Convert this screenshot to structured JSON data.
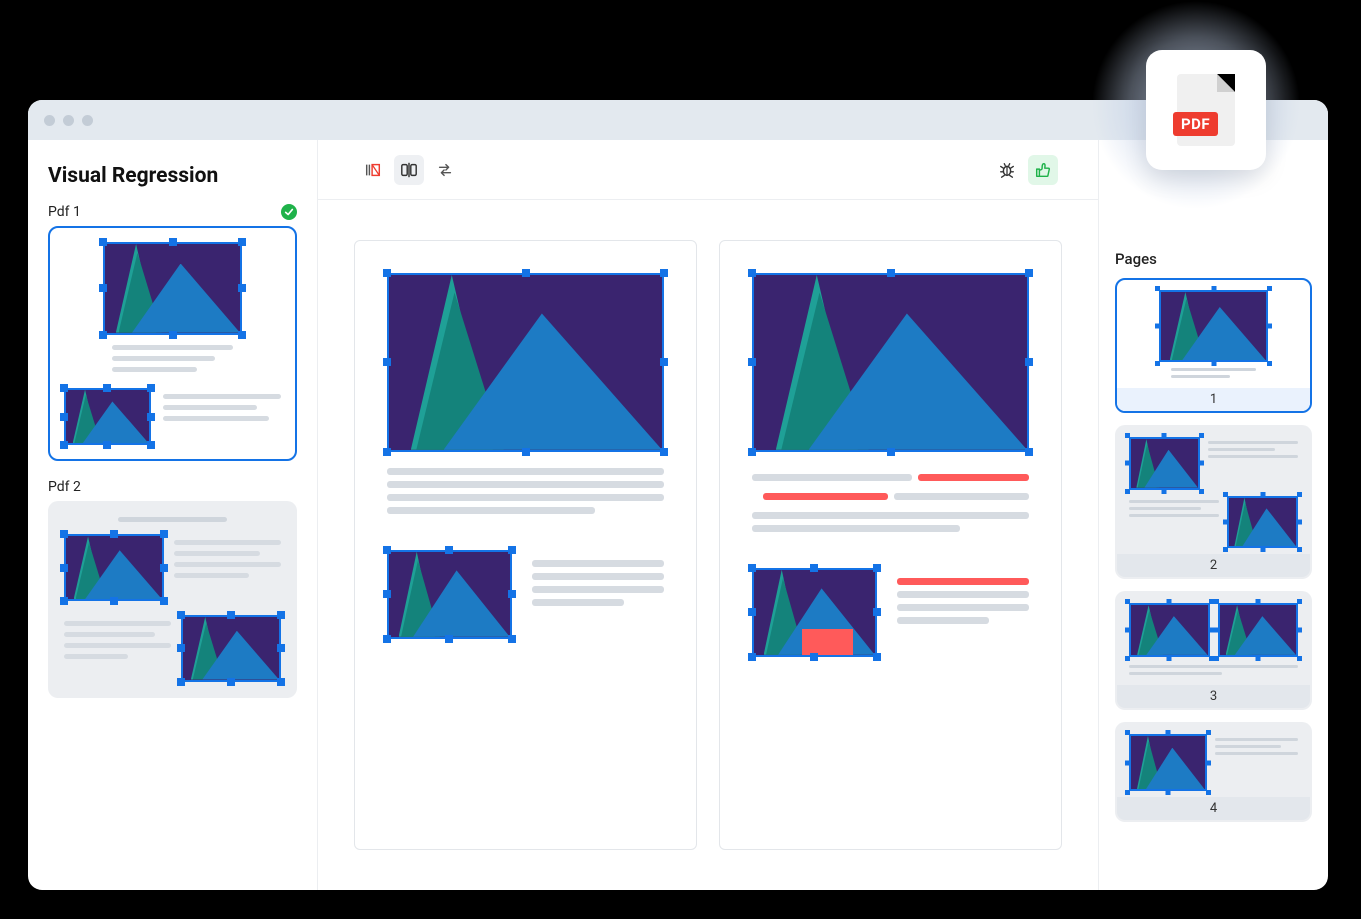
{
  "badge": {
    "label": "PDF"
  },
  "sidebar": {
    "title": "Visual Regression",
    "docs": [
      {
        "label": "Pdf 1",
        "status": "success",
        "selected": true
      },
      {
        "label": "Pdf 2",
        "status": "none",
        "selected": false
      }
    ]
  },
  "toolbar": {
    "left": [
      {
        "name": "highlight-diff-icon",
        "active": false
      },
      {
        "name": "split-compare-icon",
        "active": true
      },
      {
        "name": "swap-icon",
        "active": false
      }
    ],
    "right": [
      {
        "name": "bug-icon",
        "style": "plain"
      },
      {
        "name": "thumbs-up-icon",
        "style": "approve"
      }
    ]
  },
  "pages_panel": {
    "title": "Pages",
    "items": [
      {
        "num": "1",
        "selected": true
      },
      {
        "num": "2",
        "selected": false
      },
      {
        "num": "3",
        "selected": false
      },
      {
        "num": "4",
        "selected": false
      }
    ]
  }
}
